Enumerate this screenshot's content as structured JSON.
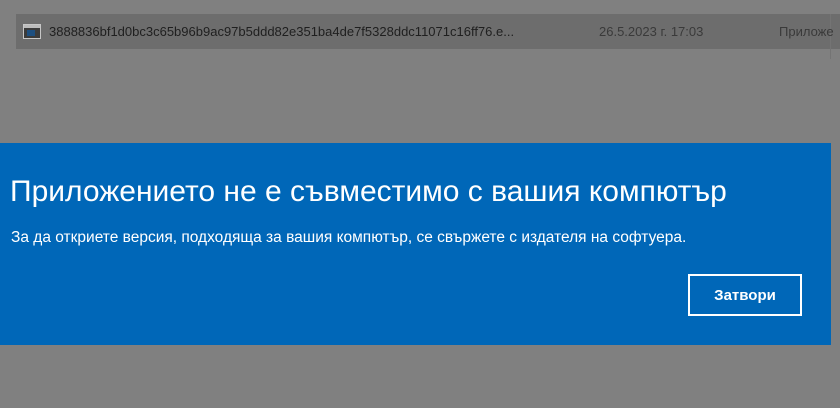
{
  "explorer": {
    "row": {
      "icon": "app-window-icon",
      "name": "3888836bf1d0bc3c65b96b9ac97b5ddd82e351ba4de7f5328ddc11071c16ff76.e...",
      "date": "26.5.2023 г. 17:03",
      "type": "Приложе"
    }
  },
  "dialog": {
    "title": "Приложението не е съвместимо с вашия компютър",
    "message": "За да откриете версия, подходяща за вашия компютър, се свържете с издателя на софтуера.",
    "close_label": "Затвори",
    "colors": {
      "background": "#0067b8",
      "text": "#ffffff"
    }
  }
}
